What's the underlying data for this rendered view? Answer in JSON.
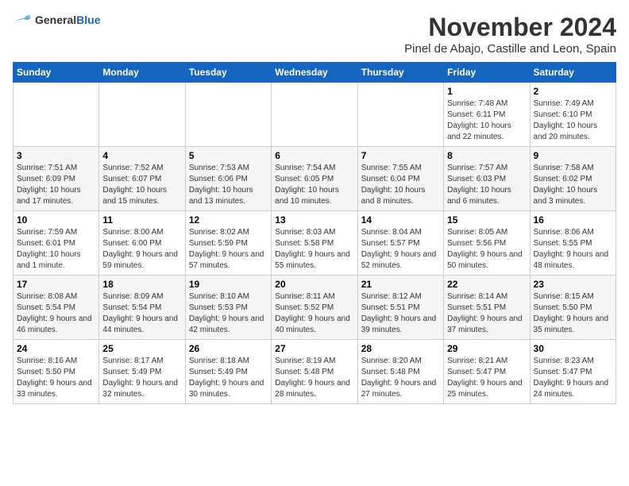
{
  "header": {
    "logo_general": "General",
    "logo_blue": "Blue",
    "month": "November 2024",
    "location": "Pinel de Abajo, Castille and Leon, Spain"
  },
  "columns": [
    "Sunday",
    "Monday",
    "Tuesday",
    "Wednesday",
    "Thursday",
    "Friday",
    "Saturday"
  ],
  "weeks": [
    {
      "days": [
        {
          "num": "",
          "info": ""
        },
        {
          "num": "",
          "info": ""
        },
        {
          "num": "",
          "info": ""
        },
        {
          "num": "",
          "info": ""
        },
        {
          "num": "",
          "info": ""
        },
        {
          "num": "1",
          "info": "Sunrise: 7:48 AM\nSunset: 6:11 PM\nDaylight: 10 hours and 22 minutes."
        },
        {
          "num": "2",
          "info": "Sunrise: 7:49 AM\nSunset: 6:10 PM\nDaylight: 10 hours and 20 minutes."
        }
      ]
    },
    {
      "days": [
        {
          "num": "3",
          "info": "Sunrise: 7:51 AM\nSunset: 6:09 PM\nDaylight: 10 hours and 17 minutes."
        },
        {
          "num": "4",
          "info": "Sunrise: 7:52 AM\nSunset: 6:07 PM\nDaylight: 10 hours and 15 minutes."
        },
        {
          "num": "5",
          "info": "Sunrise: 7:53 AM\nSunset: 6:06 PM\nDaylight: 10 hours and 13 minutes."
        },
        {
          "num": "6",
          "info": "Sunrise: 7:54 AM\nSunset: 6:05 PM\nDaylight: 10 hours and 10 minutes."
        },
        {
          "num": "7",
          "info": "Sunrise: 7:55 AM\nSunset: 6:04 PM\nDaylight: 10 hours and 8 minutes."
        },
        {
          "num": "8",
          "info": "Sunrise: 7:57 AM\nSunset: 6:03 PM\nDaylight: 10 hours and 6 minutes."
        },
        {
          "num": "9",
          "info": "Sunrise: 7:58 AM\nSunset: 6:02 PM\nDaylight: 10 hours and 3 minutes."
        }
      ]
    },
    {
      "days": [
        {
          "num": "10",
          "info": "Sunrise: 7:59 AM\nSunset: 6:01 PM\nDaylight: 10 hours and 1 minute."
        },
        {
          "num": "11",
          "info": "Sunrise: 8:00 AM\nSunset: 6:00 PM\nDaylight: 9 hours and 59 minutes."
        },
        {
          "num": "12",
          "info": "Sunrise: 8:02 AM\nSunset: 5:59 PM\nDaylight: 9 hours and 57 minutes."
        },
        {
          "num": "13",
          "info": "Sunrise: 8:03 AM\nSunset: 5:58 PM\nDaylight: 9 hours and 55 minutes."
        },
        {
          "num": "14",
          "info": "Sunrise: 8:04 AM\nSunset: 5:57 PM\nDaylight: 9 hours and 52 minutes."
        },
        {
          "num": "15",
          "info": "Sunrise: 8:05 AM\nSunset: 5:56 PM\nDaylight: 9 hours and 50 minutes."
        },
        {
          "num": "16",
          "info": "Sunrise: 8:06 AM\nSunset: 5:55 PM\nDaylight: 9 hours and 48 minutes."
        }
      ]
    },
    {
      "days": [
        {
          "num": "17",
          "info": "Sunrise: 8:08 AM\nSunset: 5:54 PM\nDaylight: 9 hours and 46 minutes."
        },
        {
          "num": "18",
          "info": "Sunrise: 8:09 AM\nSunset: 5:54 PM\nDaylight: 9 hours and 44 minutes."
        },
        {
          "num": "19",
          "info": "Sunrise: 8:10 AM\nSunset: 5:53 PM\nDaylight: 9 hours and 42 minutes."
        },
        {
          "num": "20",
          "info": "Sunrise: 8:11 AM\nSunset: 5:52 PM\nDaylight: 9 hours and 40 minutes."
        },
        {
          "num": "21",
          "info": "Sunrise: 8:12 AM\nSunset: 5:51 PM\nDaylight: 9 hours and 39 minutes."
        },
        {
          "num": "22",
          "info": "Sunrise: 8:14 AM\nSunset: 5:51 PM\nDaylight: 9 hours and 37 minutes."
        },
        {
          "num": "23",
          "info": "Sunrise: 8:15 AM\nSunset: 5:50 PM\nDaylight: 9 hours and 35 minutes."
        }
      ]
    },
    {
      "days": [
        {
          "num": "24",
          "info": "Sunrise: 8:16 AM\nSunset: 5:50 PM\nDaylight: 9 hours and 33 minutes."
        },
        {
          "num": "25",
          "info": "Sunrise: 8:17 AM\nSunset: 5:49 PM\nDaylight: 9 hours and 32 minutes."
        },
        {
          "num": "26",
          "info": "Sunrise: 8:18 AM\nSunset: 5:49 PM\nDaylight: 9 hours and 30 minutes."
        },
        {
          "num": "27",
          "info": "Sunrise: 8:19 AM\nSunset: 5:48 PM\nDaylight: 9 hours and 28 minutes."
        },
        {
          "num": "28",
          "info": "Sunrise: 8:20 AM\nSunset: 5:48 PM\nDaylight: 9 hours and 27 minutes."
        },
        {
          "num": "29",
          "info": "Sunrise: 8:21 AM\nSunset: 5:47 PM\nDaylight: 9 hours and 25 minutes."
        },
        {
          "num": "30",
          "info": "Sunrise: 8:23 AM\nSunset: 5:47 PM\nDaylight: 9 hours and 24 minutes."
        }
      ]
    }
  ]
}
